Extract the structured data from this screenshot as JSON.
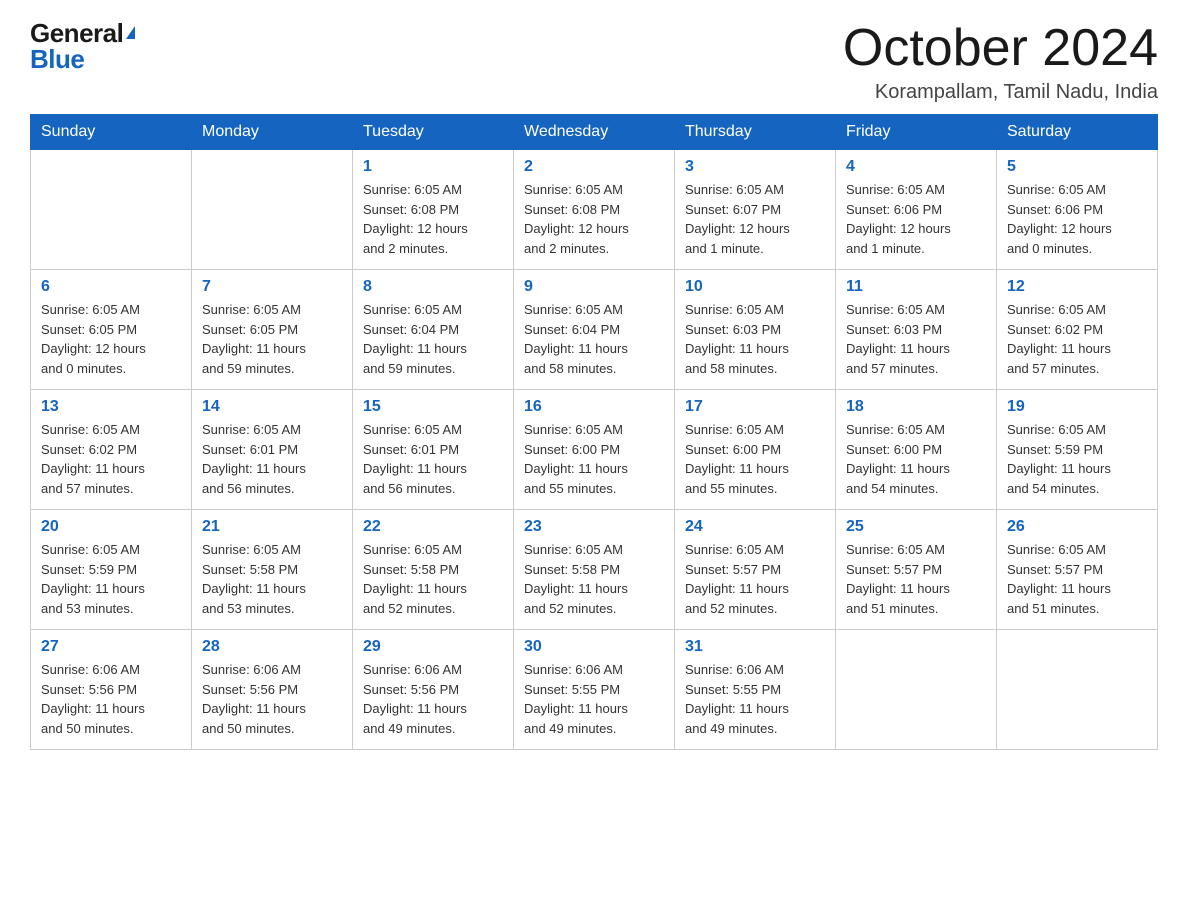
{
  "logo": {
    "general": "General",
    "blue": "Blue"
  },
  "header": {
    "month_year": "October 2024",
    "location": "Korampallam, Tamil Nadu, India"
  },
  "weekdays": [
    "Sunday",
    "Monday",
    "Tuesday",
    "Wednesday",
    "Thursday",
    "Friday",
    "Saturday"
  ],
  "weeks": [
    [
      {
        "day": "",
        "info": ""
      },
      {
        "day": "",
        "info": ""
      },
      {
        "day": "1",
        "info": "Sunrise: 6:05 AM\nSunset: 6:08 PM\nDaylight: 12 hours\nand 2 minutes."
      },
      {
        "day": "2",
        "info": "Sunrise: 6:05 AM\nSunset: 6:08 PM\nDaylight: 12 hours\nand 2 minutes."
      },
      {
        "day": "3",
        "info": "Sunrise: 6:05 AM\nSunset: 6:07 PM\nDaylight: 12 hours\nand 1 minute."
      },
      {
        "day": "4",
        "info": "Sunrise: 6:05 AM\nSunset: 6:06 PM\nDaylight: 12 hours\nand 1 minute."
      },
      {
        "day": "5",
        "info": "Sunrise: 6:05 AM\nSunset: 6:06 PM\nDaylight: 12 hours\nand 0 minutes."
      }
    ],
    [
      {
        "day": "6",
        "info": "Sunrise: 6:05 AM\nSunset: 6:05 PM\nDaylight: 12 hours\nand 0 minutes."
      },
      {
        "day": "7",
        "info": "Sunrise: 6:05 AM\nSunset: 6:05 PM\nDaylight: 11 hours\nand 59 minutes."
      },
      {
        "day": "8",
        "info": "Sunrise: 6:05 AM\nSunset: 6:04 PM\nDaylight: 11 hours\nand 59 minutes."
      },
      {
        "day": "9",
        "info": "Sunrise: 6:05 AM\nSunset: 6:04 PM\nDaylight: 11 hours\nand 58 minutes."
      },
      {
        "day": "10",
        "info": "Sunrise: 6:05 AM\nSunset: 6:03 PM\nDaylight: 11 hours\nand 58 minutes."
      },
      {
        "day": "11",
        "info": "Sunrise: 6:05 AM\nSunset: 6:03 PM\nDaylight: 11 hours\nand 57 minutes."
      },
      {
        "day": "12",
        "info": "Sunrise: 6:05 AM\nSunset: 6:02 PM\nDaylight: 11 hours\nand 57 minutes."
      }
    ],
    [
      {
        "day": "13",
        "info": "Sunrise: 6:05 AM\nSunset: 6:02 PM\nDaylight: 11 hours\nand 57 minutes."
      },
      {
        "day": "14",
        "info": "Sunrise: 6:05 AM\nSunset: 6:01 PM\nDaylight: 11 hours\nand 56 minutes."
      },
      {
        "day": "15",
        "info": "Sunrise: 6:05 AM\nSunset: 6:01 PM\nDaylight: 11 hours\nand 56 minutes."
      },
      {
        "day": "16",
        "info": "Sunrise: 6:05 AM\nSunset: 6:00 PM\nDaylight: 11 hours\nand 55 minutes."
      },
      {
        "day": "17",
        "info": "Sunrise: 6:05 AM\nSunset: 6:00 PM\nDaylight: 11 hours\nand 55 minutes."
      },
      {
        "day": "18",
        "info": "Sunrise: 6:05 AM\nSunset: 6:00 PM\nDaylight: 11 hours\nand 54 minutes."
      },
      {
        "day": "19",
        "info": "Sunrise: 6:05 AM\nSunset: 5:59 PM\nDaylight: 11 hours\nand 54 minutes."
      }
    ],
    [
      {
        "day": "20",
        "info": "Sunrise: 6:05 AM\nSunset: 5:59 PM\nDaylight: 11 hours\nand 53 minutes."
      },
      {
        "day": "21",
        "info": "Sunrise: 6:05 AM\nSunset: 5:58 PM\nDaylight: 11 hours\nand 53 minutes."
      },
      {
        "day": "22",
        "info": "Sunrise: 6:05 AM\nSunset: 5:58 PM\nDaylight: 11 hours\nand 52 minutes."
      },
      {
        "day": "23",
        "info": "Sunrise: 6:05 AM\nSunset: 5:58 PM\nDaylight: 11 hours\nand 52 minutes."
      },
      {
        "day": "24",
        "info": "Sunrise: 6:05 AM\nSunset: 5:57 PM\nDaylight: 11 hours\nand 52 minutes."
      },
      {
        "day": "25",
        "info": "Sunrise: 6:05 AM\nSunset: 5:57 PM\nDaylight: 11 hours\nand 51 minutes."
      },
      {
        "day": "26",
        "info": "Sunrise: 6:05 AM\nSunset: 5:57 PM\nDaylight: 11 hours\nand 51 minutes."
      }
    ],
    [
      {
        "day": "27",
        "info": "Sunrise: 6:06 AM\nSunset: 5:56 PM\nDaylight: 11 hours\nand 50 minutes."
      },
      {
        "day": "28",
        "info": "Sunrise: 6:06 AM\nSunset: 5:56 PM\nDaylight: 11 hours\nand 50 minutes."
      },
      {
        "day": "29",
        "info": "Sunrise: 6:06 AM\nSunset: 5:56 PM\nDaylight: 11 hours\nand 49 minutes."
      },
      {
        "day": "30",
        "info": "Sunrise: 6:06 AM\nSunset: 5:55 PM\nDaylight: 11 hours\nand 49 minutes."
      },
      {
        "day": "31",
        "info": "Sunrise: 6:06 AM\nSunset: 5:55 PM\nDaylight: 11 hours\nand 49 minutes."
      },
      {
        "day": "",
        "info": ""
      },
      {
        "day": "",
        "info": ""
      }
    ]
  ]
}
